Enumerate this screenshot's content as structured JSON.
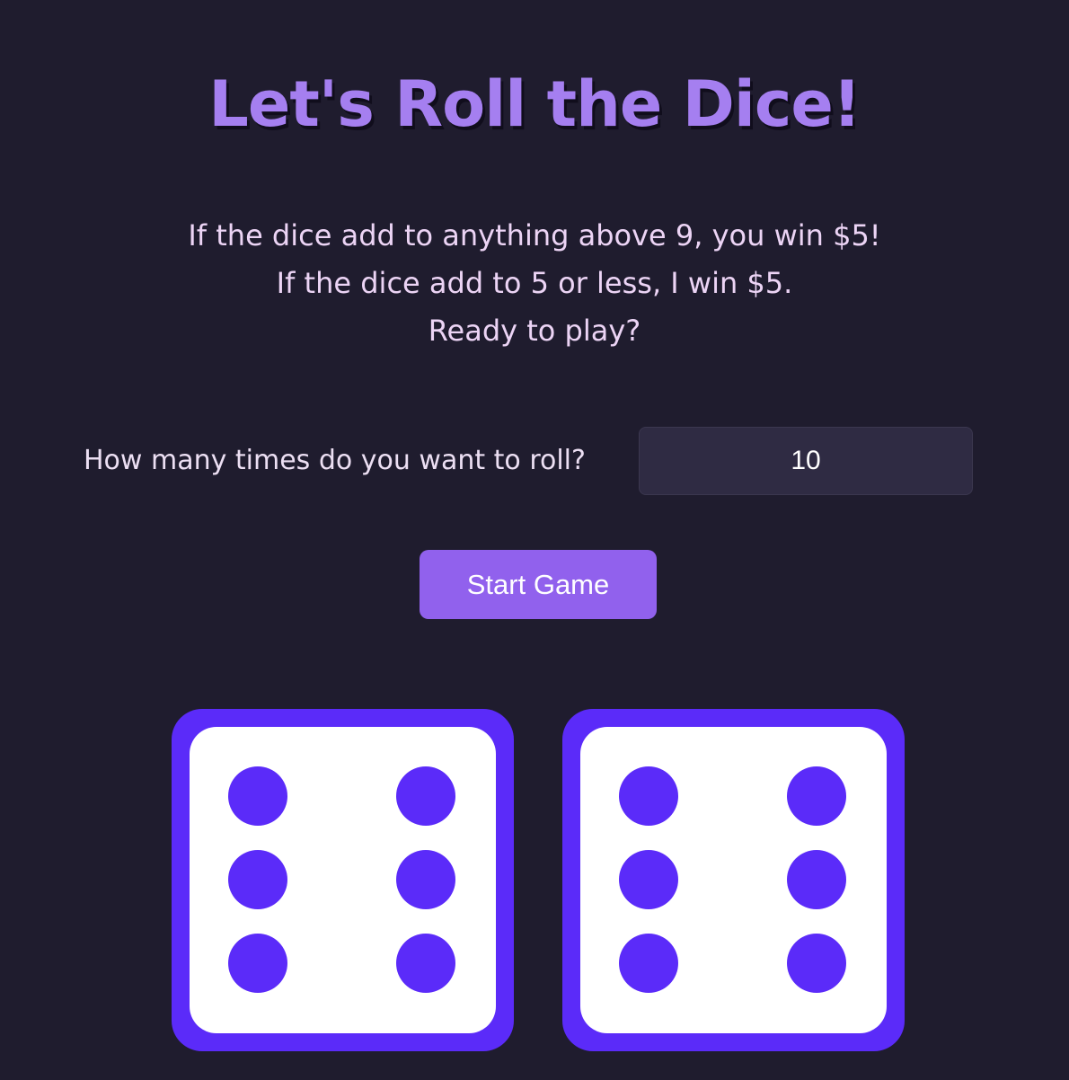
{
  "title": "Let's Roll the Dice!",
  "rules": {
    "line1": "If the dice add to anything above 9, you win $5!",
    "line2": "If the dice add to 5 or less, I win $5.",
    "line3": "Ready to play?"
  },
  "roll_input": {
    "label": "How many times do you want to roll?",
    "value": "10"
  },
  "start_button": {
    "label": "Start Game"
  },
  "dice": [
    {
      "value": 6
    },
    {
      "value": 6
    }
  ],
  "colors": {
    "background": "#1f1c2e",
    "title": "#a57ff0",
    "accent": "#9161ed",
    "die": "#5b2bf9",
    "die_face": "#ffffff"
  }
}
